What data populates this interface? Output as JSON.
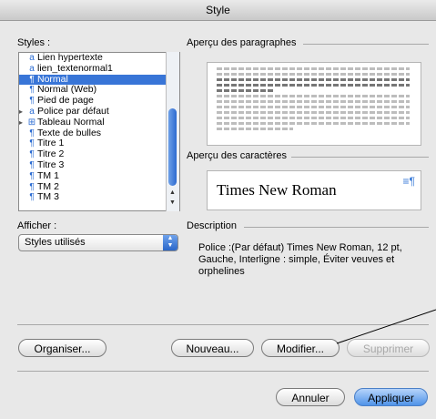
{
  "window": {
    "title": "Style"
  },
  "styles_label": "Styles :",
  "styles": [
    {
      "label": "Lien hypertexte",
      "icon": "a",
      "selected": false,
      "expander": ""
    },
    {
      "label": "lien_textenormal1",
      "icon": "a",
      "selected": false,
      "expander": ""
    },
    {
      "label": "Normal",
      "icon": "¶",
      "selected": true,
      "expander": ""
    },
    {
      "label": "Normal (Web)",
      "icon": "¶",
      "selected": false,
      "expander": ""
    },
    {
      "label": "Pied de page",
      "icon": "¶",
      "selected": false,
      "expander": ""
    },
    {
      "label": "Police par défaut",
      "icon": "a",
      "selected": false,
      "expander": "▸"
    },
    {
      "label": "Tableau Normal",
      "icon": "⊞",
      "selected": false,
      "expander": "▸"
    },
    {
      "label": "Texte de bulles",
      "icon": "¶",
      "selected": false,
      "expander": ""
    },
    {
      "label": "Titre 1",
      "icon": "¶",
      "selected": false,
      "expander": ""
    },
    {
      "label": "Titre 2",
      "icon": "¶",
      "selected": false,
      "expander": ""
    },
    {
      "label": "Titre 3",
      "icon": "¶",
      "selected": false,
      "expander": ""
    },
    {
      "label": "TM 1",
      "icon": "¶",
      "selected": false,
      "expander": ""
    },
    {
      "label": "TM 2",
      "icon": "¶",
      "selected": false,
      "expander": ""
    },
    {
      "label": "TM 3",
      "icon": "¶",
      "selected": false,
      "expander": ""
    }
  ],
  "afficher_label": "Afficher :",
  "afficher_value": "Styles utilisés",
  "para_preview_label": "Aperçu des paragraphes",
  "char_preview_label": "Aperçu des caractères",
  "char_preview_sample": "Times New Roman",
  "description_label": "Description",
  "description_text": "Police :(Par défaut) Times New Roman, 12 pt, Gauche, Interligne : simple, Éviter veuves et orphelines",
  "buttons": {
    "organiser": "Organiser...",
    "nouveau": "Nouveau...",
    "modifier": "Modifier...",
    "supprimer": "Supprimer",
    "annuler": "Annuler",
    "appliquer": "Appliquer"
  },
  "colors": {
    "selection": "#3875d7",
    "accent": "#4f93e8"
  }
}
